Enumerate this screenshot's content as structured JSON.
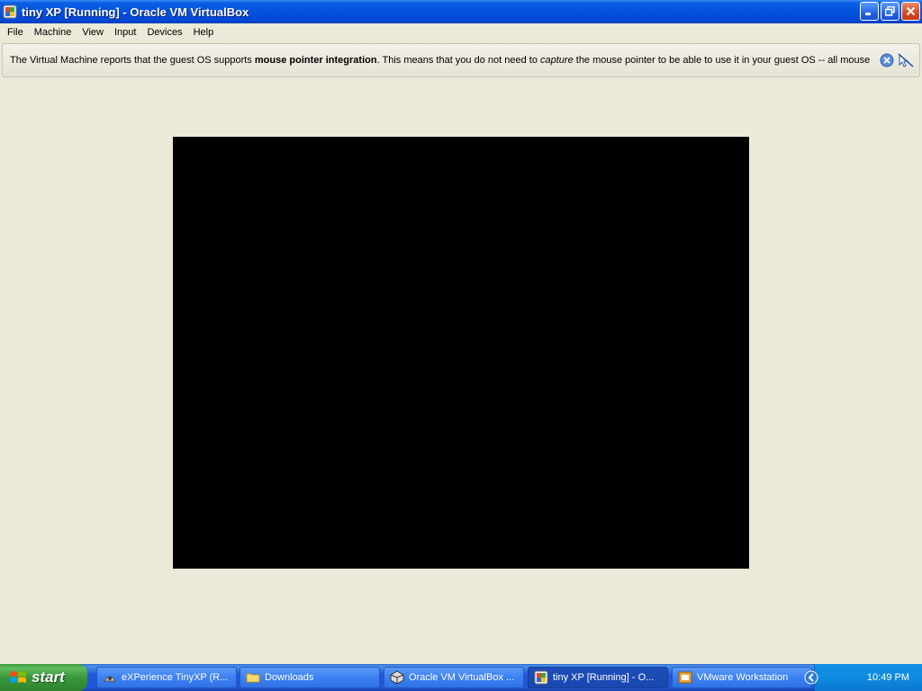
{
  "window": {
    "title": "tiny XP [Running] - Oracle VM VirtualBox",
    "icon": "virtualbox-window-icon",
    "controls": {
      "minimize": "minimize-icon",
      "restore": "restore-icon",
      "close": "close-icon"
    }
  },
  "menubar": {
    "items": [
      "File",
      "Machine",
      "View",
      "Input",
      "Devices",
      "Help"
    ]
  },
  "banner": {
    "text_1": "The Virtual Machine reports that the guest OS supports ",
    "bold": "mouse pointer integration",
    "text_2": ". This means that you do not need to ",
    "italic": "capture",
    "text_3": " the mouse pointer to be able to use it in your guest OS -- all mouse",
    "icons": [
      "close-banner-icon",
      "mouse-integration-icon"
    ]
  },
  "taskbar": {
    "start_label": "start",
    "buttons": [
      {
        "label": "eXPerience TinyXP (R...",
        "icon": "tinyxp-icon",
        "active": false
      },
      {
        "label": "Downloads",
        "icon": "folder-icon",
        "active": false
      },
      {
        "label": "Oracle VM VirtualBox ...",
        "icon": "virtualbox-icon",
        "active": false
      },
      {
        "label": "tiny XP [Running] - O...",
        "icon": "vm-window-icon",
        "active": true
      },
      {
        "label": "VMware Workstation",
        "icon": "vmware-icon",
        "active": false
      }
    ],
    "tray": {
      "clock": "10:49 PM",
      "icons": [
        "keyboard-icon",
        "expand-tray-icon"
      ]
    }
  },
  "colors": {
    "titlebar": "#0453DD",
    "desktop_bg": "#ECE9D8",
    "vm_screen": "#000000",
    "taskbar": "#2157D7",
    "start_button": "#3A973A"
  }
}
